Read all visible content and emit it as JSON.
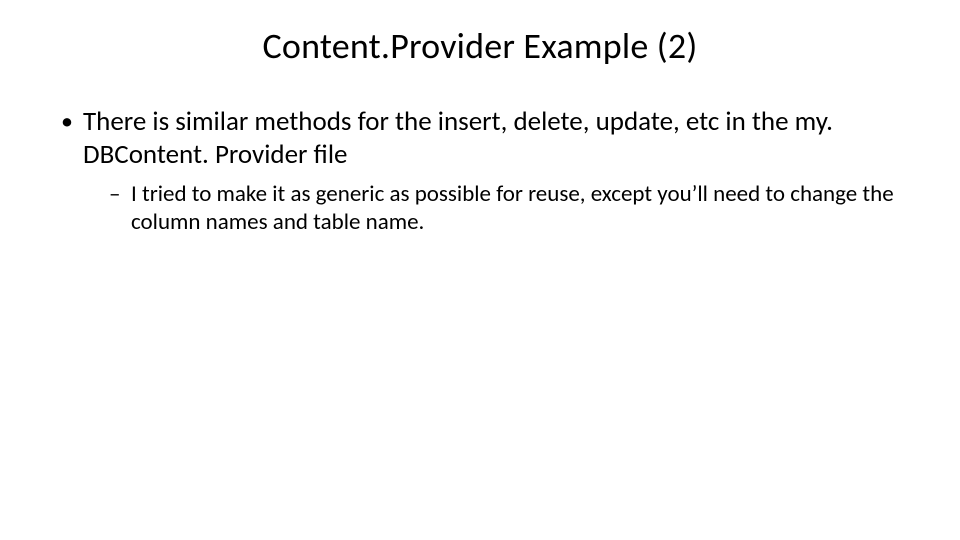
{
  "title": "Content.Provider Example (2)",
  "bullets": {
    "item1": "There is similar methods for the insert, delete, update, etc in the my. DBContent. Provider file",
    "sub1": "I tried to make it as generic as possible for reuse, except you’ll need to change the column names and table name."
  }
}
